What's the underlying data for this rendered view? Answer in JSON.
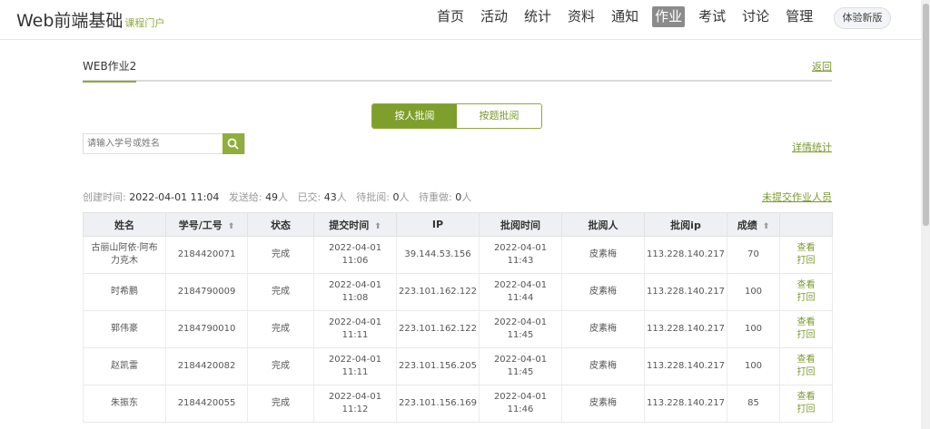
{
  "header": {
    "logo": "Web前端基础",
    "logo_sub": "课程门户",
    "nav": [
      "首页",
      "活动",
      "统计",
      "资料",
      "通知",
      "作业",
      "考试",
      "讨论",
      "管理"
    ],
    "active_nav": "作业",
    "beta_label": "体验新版"
  },
  "page": {
    "title": "WEB作业2",
    "back_label": "返回"
  },
  "toggle": {
    "by_student": "按人批阅",
    "by_question": "按题批阅"
  },
  "search": {
    "placeholder": "请输入学号或姓名"
  },
  "detail_stats_label": "详情统计",
  "stats": {
    "created_label": "创建时间:",
    "created_value": "2022-04-01 11:04",
    "sent_label": "发送给:",
    "sent_value": "49",
    "submitted_label": "已交:",
    "submitted_value": "43",
    "pending_label": "待批阅:",
    "pending_value": "0",
    "redo_label": "待重做:",
    "redo_value": "0",
    "unit": "人",
    "unsubmitted_label": "未提交作业人员"
  },
  "table": {
    "headers": [
      "姓名",
      "学号/工号",
      "状态",
      "提交时间",
      "IP",
      "批阅时间",
      "批阅人",
      "批阅ip",
      "成绩",
      ""
    ],
    "rows": [
      {
        "name": "古丽山阿依·阿布力克木",
        "id": "2184420071",
        "status": "完成",
        "submit_time": "2022-04-01 11:06",
        "ip": "39.144.53.156",
        "review_time": "2022-04-01 11:43",
        "reviewer": "皮素梅",
        "review_ip": "113.228.140.217",
        "score": "70",
        "view": "查看",
        "return": "打回"
      },
      {
        "name": "时希鹏",
        "id": "2184790009",
        "status": "完成",
        "submit_time": "2022-04-01 11:08",
        "ip": "223.101.162.122",
        "review_time": "2022-04-01 11:44",
        "reviewer": "皮素梅",
        "review_ip": "113.228.140.217",
        "score": "100",
        "view": "查看",
        "return": "打回"
      },
      {
        "name": "郭伟豪",
        "id": "2184790010",
        "status": "完成",
        "submit_time": "2022-04-01 11:11",
        "ip": "223.101.162.122",
        "review_time": "2022-04-01 11:45",
        "reviewer": "皮素梅",
        "review_ip": "113.228.140.217",
        "score": "100",
        "view": "查看",
        "return": "打回"
      },
      {
        "name": "赵凯雷",
        "id": "2184420082",
        "status": "完成",
        "submit_time": "2022-04-01 11:11",
        "ip": "223.101.156.205",
        "review_time": "2022-04-01 11:45",
        "reviewer": "皮素梅",
        "review_ip": "113.228.140.217",
        "score": "100",
        "view": "查看",
        "return": "打回"
      },
      {
        "name": "朱振东",
        "id": "2184420055",
        "status": "完成",
        "submit_time": "2022-04-01 11:12",
        "ip": "223.101.156.169",
        "review_time": "2022-04-01 11:46",
        "reviewer": "皮素梅",
        "review_ip": "113.228.140.217",
        "score": "85",
        "view": "查看",
        "return": "打回"
      }
    ]
  },
  "colors": {
    "accent": "#8fa83a",
    "accent_dark": "#7f9f2d",
    "link": "#7a9a2e"
  }
}
